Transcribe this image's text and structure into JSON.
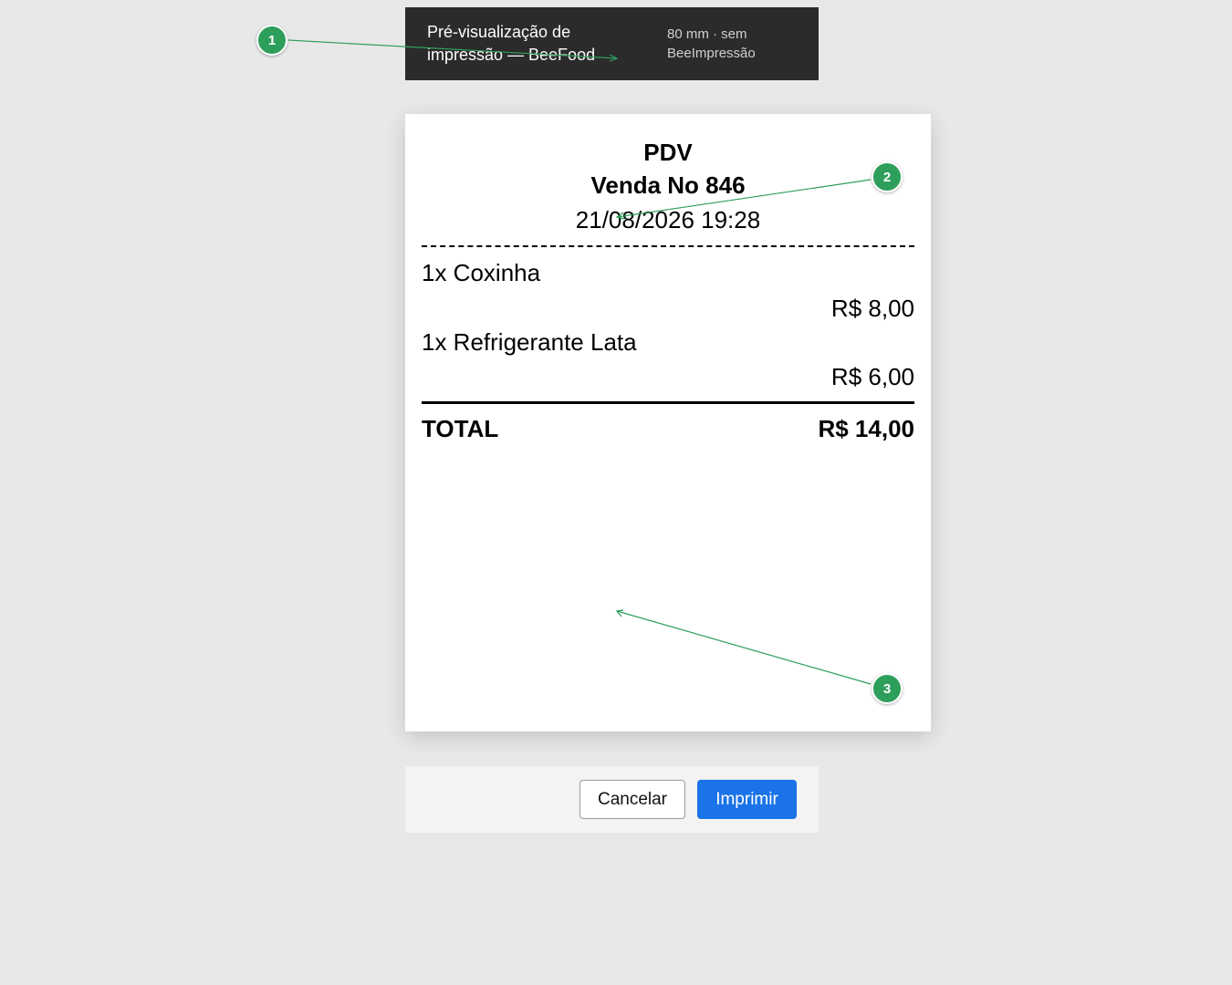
{
  "header": {
    "title": "Pré-visualização de impressão — BeeFood",
    "meta": "80 mm · sem BeeImpressão"
  },
  "receipt": {
    "store": "PDV",
    "sale": "Venda No 846",
    "datetime": "21/08/2026 19:28",
    "items": [
      {
        "name": "1x Coxinha",
        "price": "R$ 8,00"
      },
      {
        "name": "1x Refrigerante Lata",
        "price": "R$ 6,00"
      }
    ],
    "total_label": "TOTAL",
    "total_value": "R$ 14,00"
  },
  "actions": {
    "cancel_label": "Cancelar",
    "print_label": "Imprimir"
  },
  "annotations": {
    "badges": [
      "1",
      "2",
      "3"
    ],
    "color": "#2e9e5b"
  },
  "colors": {
    "header_bg": "#2b2b2b",
    "primary": "#1a73e8",
    "page_bg": "#e8e8e8"
  }
}
